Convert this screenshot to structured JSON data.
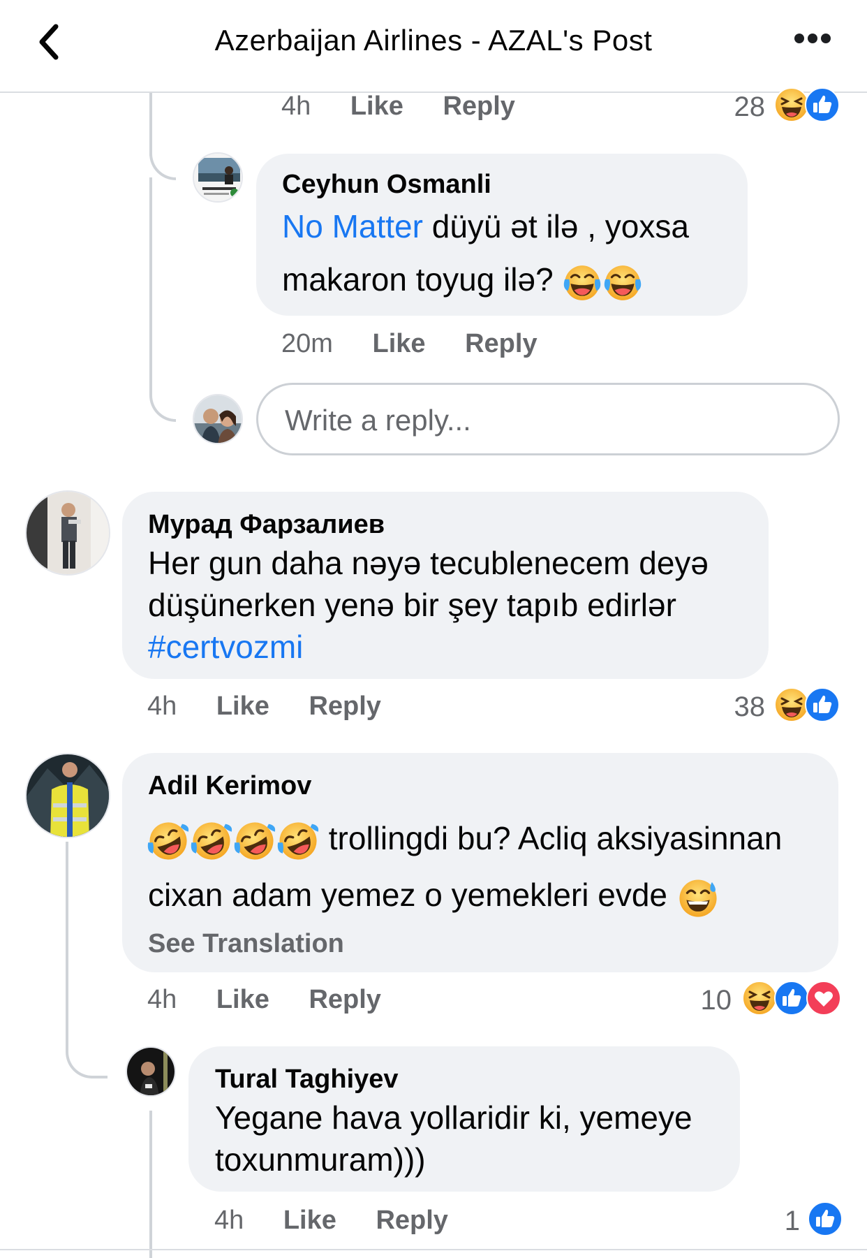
{
  "header": {
    "title": "Azerbaijan Airlines - AZAL's Post"
  },
  "comments": [
    {
      "meta": {
        "time": "4h",
        "like": "Like",
        "reply": "Reply",
        "reaction_count": "28",
        "reactions": [
          "haha-icon",
          "like-icon"
        ]
      }
    },
    {
      "name": "Ceyhun Osmanli",
      "mention": "No Matter",
      "text_line1": " düyü ət ilə , yoxsa",
      "text_line2": "makaron toyug ilə?",
      "emojis": [
        "joy-emoji",
        "joy-emoji"
      ],
      "meta": {
        "time": "20m",
        "like": "Like",
        "reply": "Reply"
      }
    },
    {
      "name": "Мурад Фарзалиев",
      "text_line1": "Her gun daha nəyə tecublenecem deyə",
      "text_line2": "düşünerken yenə bir şey tapıb edirlər",
      "hashtag": "#certvozmi",
      "meta": {
        "time": "4h",
        "like": "Like",
        "reply": "Reply",
        "reaction_count": "38",
        "reactions": [
          "haha-icon",
          "like-icon"
        ]
      }
    },
    {
      "name": "Adil Kerimov",
      "text_line1": " trollingdi bu? Acliq aksiyasinnan",
      "text_line2": "cixan adam yemez o yemekleri evde",
      "see_translation": "See Translation",
      "emojis_line1": [
        "rofl-emoji",
        "rofl-emoji",
        "rofl-emoji",
        "rofl-emoji"
      ],
      "emoji_line2": "sweat-smile-emoji",
      "meta": {
        "time": "4h",
        "like": "Like",
        "reply": "Reply",
        "reaction_count": "10",
        "reactions": [
          "haha-icon",
          "like-icon",
          "love-icon"
        ]
      }
    },
    {
      "name": "Tural Taghiyev",
      "text_line1": "Yegane hava yollaridir ki, yemeye",
      "text_line2": "toxunmuram)))",
      "meta": {
        "time": "4h",
        "like": "Like",
        "reply": "Reply",
        "reaction_count": "1",
        "reactions": [
          "like-icon"
        ]
      }
    }
  ],
  "reply_box": {
    "placeholder": "Write a reply..."
  },
  "colors": {
    "link": "#1877f2",
    "bubble": "#f0f2f5",
    "meta": "#65676b",
    "like": "#1877f2",
    "love": "#f33e58",
    "haha": "#f7b125"
  }
}
